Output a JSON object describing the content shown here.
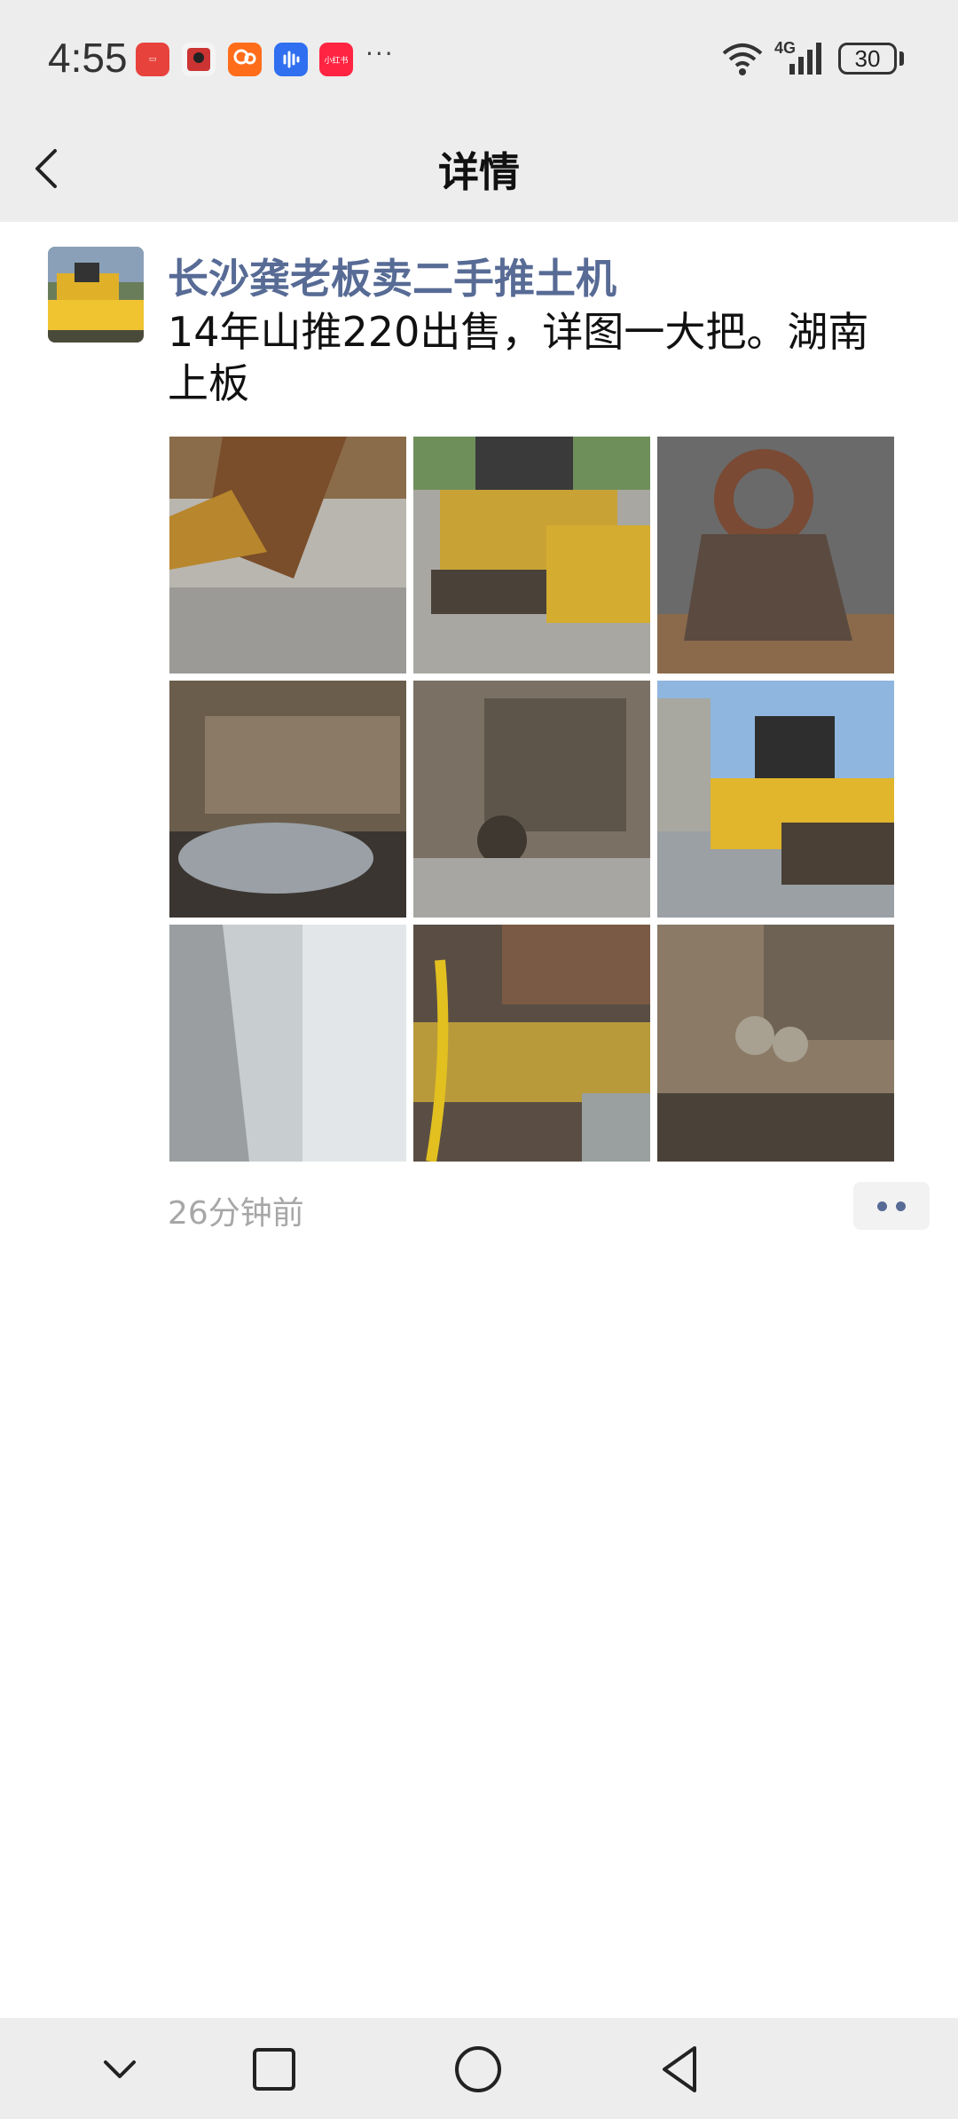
{
  "status_bar": {
    "time": "4:55",
    "network": "4G",
    "battery": "30",
    "app_icons": [
      "huawei-store-icon",
      "video-app-icon",
      "kuaishou-icon",
      "voice-app-icon",
      "xiaohongshu-icon"
    ],
    "xiaohongshu_label": "小红书",
    "more": "···"
  },
  "title_bar": {
    "title": "详情",
    "back_icon": "chevron-left-icon"
  },
  "post": {
    "author": "长沙龚老板卖二手推土机",
    "text": "14年山推220出售，详图一大把。湖南上板",
    "timestamp": "26分钟前",
    "photos": [
      "blade-closeup",
      "bulldozer-front",
      "tow-hook",
      "undercarriage-1",
      "undercarriage-2",
      "bulldozer-side",
      "metal-plate",
      "engine-bay",
      "track-frame"
    ]
  },
  "colors": {
    "link": "#576b95",
    "bar_bg": "#ededed",
    "timestamp": "#a7a7a7"
  }
}
